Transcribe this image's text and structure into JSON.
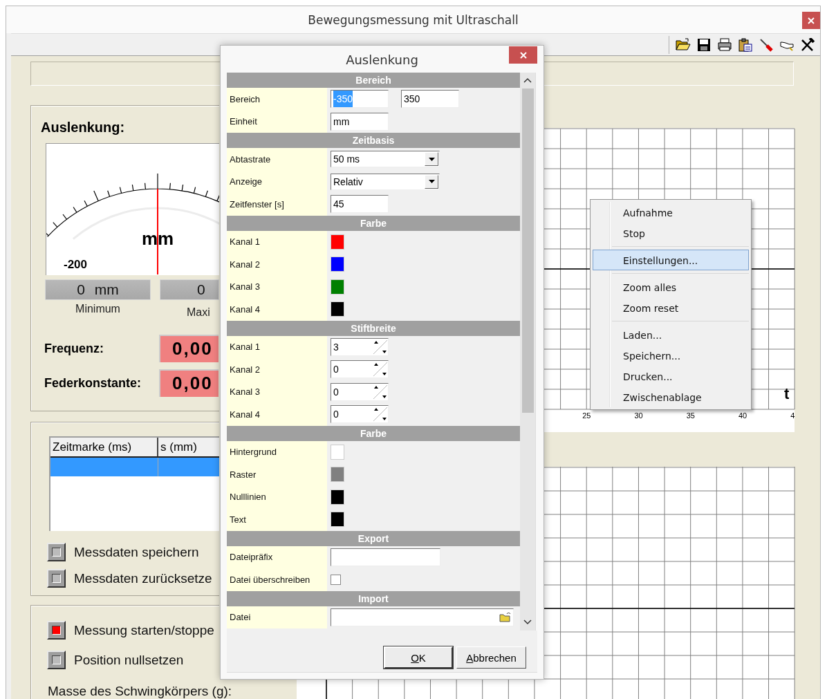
{
  "window": {
    "title": "Bewegungsmessung mit Ultraschall"
  },
  "displacement_panel": {
    "title": "Auslenkung:",
    "gauge": {
      "unit": "mm",
      "scale_label": "-200"
    },
    "minimum": {
      "value": "0 mm",
      "label": "Minimum"
    },
    "maximum": {
      "value": "0",
      "label": "Maxi"
    },
    "readouts": [
      {
        "label": "Frequenz:",
        "value": "0,00"
      },
      {
        "label": "Federkonstante:",
        "value": "0,00"
      }
    ]
  },
  "data_panel": {
    "table": {
      "columns": [
        "Zeitmarke (ms)",
        "s (mm)"
      ],
      "rows": [
        {
          "selected": true
        }
      ]
    },
    "buttons": [
      {
        "label": "Messdaten speichern",
        "on": false
      },
      {
        "label": "Messdaten zurücksetze",
        "on": false
      }
    ]
  },
  "measure_panel": {
    "buttons": [
      {
        "label": "Messung starten/stoppe",
        "on": true
      },
      {
        "label": "Position nullsetzen",
        "on": false
      }
    ],
    "mass_label": "Masse des Schwingkörpers (g):"
  },
  "top_chart": {
    "x_tick_labels": [
      "25",
      "30",
      "35",
      "40",
      "4"
    ],
    "axis_label": "t"
  },
  "dialog": {
    "title": "Auslenkung",
    "sections": [
      {
        "title": "Bereich",
        "rows": [
          {
            "label": "Bereich",
            "kind": "range",
            "values": [
              {
                "text": "-350",
                "highlighted": true
              },
              {
                "text": "350",
                "highlighted": false
              }
            ]
          },
          {
            "label": "Einheit",
            "kind": "text",
            "value": "mm"
          }
        ]
      },
      {
        "title": "Zeitbasis",
        "rows": [
          {
            "label": "Abtastrate",
            "kind": "combo",
            "value": "50 ms"
          },
          {
            "label": "Anzeige",
            "kind": "combo",
            "value": "Relativ"
          },
          {
            "label": "Zeitfenster [s]",
            "kind": "text",
            "value": "45"
          }
        ]
      },
      {
        "title": "Farbe",
        "rows": [
          {
            "label": "Kanal 1",
            "kind": "color",
            "color": "#ff0000"
          },
          {
            "label": "Kanal 2",
            "kind": "color",
            "color": "#0000ff"
          },
          {
            "label": "Kanal 3",
            "kind": "color",
            "color": "#008000"
          },
          {
            "label": "Kanal 4",
            "kind": "color",
            "color": "#000000"
          }
        ]
      },
      {
        "title": "Stiftbreite",
        "rows": [
          {
            "label": "Kanal 1",
            "kind": "spin",
            "value": "3"
          },
          {
            "label": "Kanal 2",
            "kind": "spin",
            "value": "0"
          },
          {
            "label": "Kanal 3",
            "kind": "spin",
            "value": "0"
          },
          {
            "label": "Kanal 4",
            "kind": "spin",
            "value": "0"
          }
        ]
      },
      {
        "title": "Farbe",
        "rows": [
          {
            "label": "Hintergrund",
            "kind": "color",
            "color": "#ffffff"
          },
          {
            "label": "Raster",
            "kind": "color",
            "color": "#808080"
          },
          {
            "label": "Nulllinien",
            "kind": "color",
            "color": "#000000"
          },
          {
            "label": "Text",
            "kind": "color",
            "color": "#000000"
          }
        ]
      },
      {
        "title": "Export",
        "rows": [
          {
            "label": "Dateipräfix",
            "kind": "wide_text"
          },
          {
            "label": "Datei überschreiben",
            "kind": "checkbox",
            "checked": false
          }
        ]
      },
      {
        "title": "Import",
        "rows": [
          {
            "label": "Datei",
            "kind": "file"
          }
        ]
      }
    ],
    "buttons": [
      "OK",
      "Abbrechen"
    ]
  },
  "context_menu": {
    "groups": [
      [
        {
          "label": "Aufnahme",
          "selected": false
        },
        {
          "label": "Stop",
          "selected": false
        }
      ],
      [
        {
          "label": "Einstellungen...",
          "selected": true
        }
      ],
      [
        {
          "label": "Zoom alles",
          "selected": false
        },
        {
          "label": "Zoom reset",
          "selected": false
        }
      ],
      [
        {
          "label": "Laden...",
          "selected": false
        },
        {
          "label": "Speichern...",
          "selected": false
        },
        {
          "label": "Drucken...",
          "selected": false
        },
        {
          "label": "Zwischenablage",
          "selected": false
        }
      ]
    ]
  }
}
